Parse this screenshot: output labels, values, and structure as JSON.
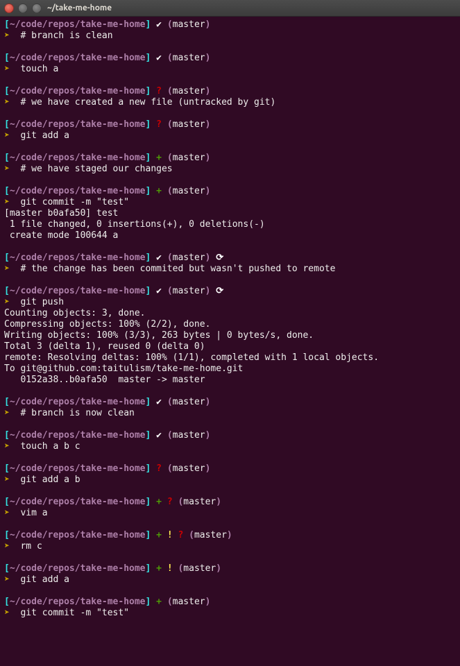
{
  "window": {
    "title": "~/take-me-home"
  },
  "path": "~/code/repos/take-me-home",
  "branch": "master",
  "symbols": {
    "bracket_open": "[",
    "bracket_close": "]",
    "prompt_arrow": "➤",
    "check": "✔",
    "question": "?",
    "plus": "+",
    "cycle": "⟳",
    "bang": "!",
    "paren_open": "(",
    "paren_close": ")"
  },
  "blocks": [
    {
      "status": [
        {
          "t": "check",
          "c": "white-bold"
        }
      ],
      "cmd": "# branch is clean",
      "out": []
    },
    {
      "status": [
        {
          "t": "check",
          "c": "white-bold"
        }
      ],
      "cmd": "touch a",
      "out": []
    },
    {
      "status": [
        {
          "t": "question",
          "c": "red-bold"
        }
      ],
      "cmd": "# we have created a new file (untracked by git)",
      "out": []
    },
    {
      "status": [
        {
          "t": "question",
          "c": "red-bold"
        }
      ],
      "cmd": "git add a",
      "out": []
    },
    {
      "status": [
        {
          "t": "plus",
          "c": "green-bold"
        }
      ],
      "cmd": "# we have staged our changes",
      "out": []
    },
    {
      "status": [
        {
          "t": "plus",
          "c": "green-bold"
        }
      ],
      "cmd": "git commit -m \"test\"",
      "out": [
        "[master b0afa50] test",
        " 1 file changed, 0 insertions(+), 0 deletions(-)",
        " create mode 100644 a"
      ]
    },
    {
      "status": [
        {
          "t": "check",
          "c": "white-bold"
        }
      ],
      "extra": [
        {
          "t": "cycle",
          "c": "white-bold"
        }
      ],
      "cmd": "# the change has been commited but wasn't pushed to remote",
      "out": []
    },
    {
      "status": [
        {
          "t": "check",
          "c": "white-bold"
        }
      ],
      "extra": [
        {
          "t": "cycle",
          "c": "white-bold"
        }
      ],
      "cmd": "git push",
      "out": [
        "Counting objects: 3, done.",
        "Compressing objects: 100% (2/2), done.",
        "Writing objects: 100% (3/3), 263 bytes | 0 bytes/s, done.",
        "Total 3 (delta 1), reused 0 (delta 0)",
        "remote: Resolving deltas: 100% (1/1), completed with 1 local objects.",
        "To git@github.com:taitulism/take-me-home.git",
        "   0152a38..b0afa50  master -> master"
      ]
    },
    {
      "status": [
        {
          "t": "check",
          "c": "white-bold"
        }
      ],
      "cmd": "# branch is now clean",
      "out": []
    },
    {
      "status": [
        {
          "t": "check",
          "c": "white-bold"
        }
      ],
      "cmd": "touch a b c",
      "out": []
    },
    {
      "status": [
        {
          "t": "question",
          "c": "red-bold"
        }
      ],
      "cmd": "git add a b",
      "out": []
    },
    {
      "status": [
        {
          "t": "plus",
          "c": "green-bold"
        },
        {
          "t": "question",
          "c": "red-bold"
        }
      ],
      "cmd": "vim a",
      "out": []
    },
    {
      "status": [
        {
          "t": "plus",
          "c": "green-bold"
        },
        {
          "t": "bang",
          "c": "yellow-bold"
        },
        {
          "t": "question",
          "c": "red-bold"
        }
      ],
      "cmd": "rm c",
      "out": []
    },
    {
      "status": [
        {
          "t": "plus",
          "c": "green-bold"
        },
        {
          "t": "bang",
          "c": "yellow-bold"
        }
      ],
      "cmd": "git add a",
      "out": []
    },
    {
      "status": [
        {
          "t": "plus",
          "c": "green-bold"
        }
      ],
      "cmd": "git commit -m \"test\"",
      "out": [],
      "last": true
    }
  ]
}
